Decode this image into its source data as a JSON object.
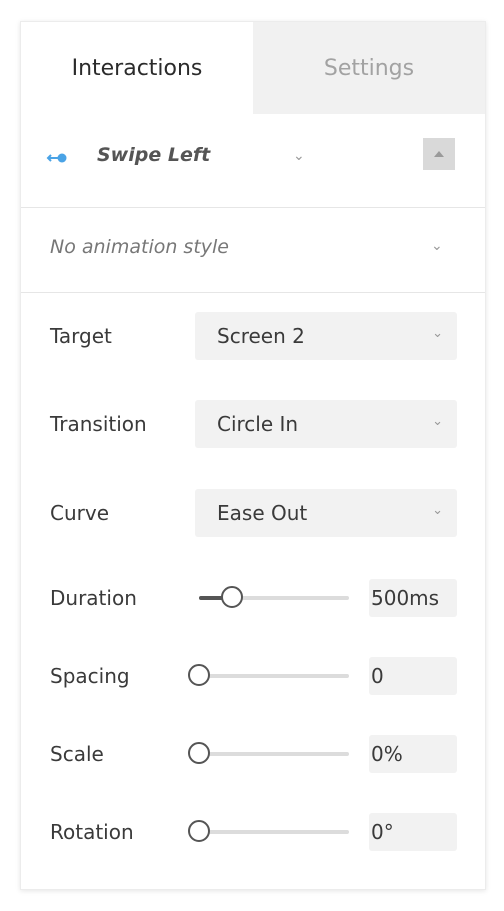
{
  "tabs": [
    {
      "label": "Interactions",
      "active": true
    },
    {
      "label": "Settings",
      "active": false
    }
  ],
  "trigger": {
    "icon": "swipe-left-icon",
    "label": "Swipe Left",
    "icon_color": "#4aa3e6"
  },
  "animation_style": {
    "label": "No animation style"
  },
  "target": {
    "label": "Target",
    "value": "Screen 2"
  },
  "transition": {
    "label": "Transition",
    "value": "Circle In"
  },
  "curve": {
    "label": "Curve",
    "value": "Ease Out"
  },
  "duration": {
    "label": "Duration",
    "value": "500ms",
    "slider_level": 0.22
  },
  "spacing": {
    "label": "Spacing",
    "value": "0",
    "slider_level": 0.0
  },
  "scale": {
    "label": "Scale",
    "value": "0%",
    "slider_level": 0.0
  },
  "rotation": {
    "label": "Rotation",
    "value": "0°",
    "slider_level": 0.0
  }
}
